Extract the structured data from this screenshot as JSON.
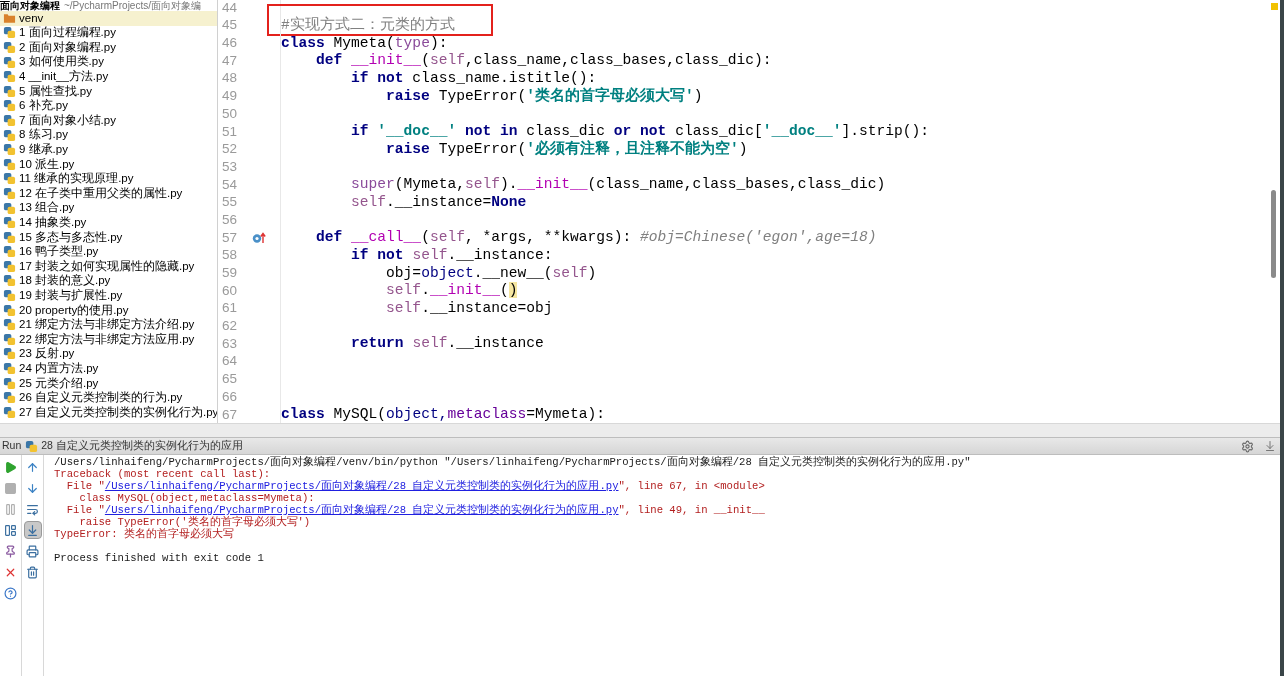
{
  "sidebar": {
    "project": "面向对象编程",
    "path": "~/PycharmProjects/面向对象编",
    "items": [
      {
        "label": "venv",
        "kind": "folder",
        "selected": true
      },
      {
        "label": "1 面向过程编程.py",
        "kind": "file",
        "selected": false
      },
      {
        "label": "2 面向对象编程.py",
        "kind": "file",
        "selected": false
      },
      {
        "label": "3 如何使用类.py",
        "kind": "file",
        "selected": false
      },
      {
        "label": "4 __init__方法.py",
        "kind": "file",
        "selected": false
      },
      {
        "label": "5 属性查找.py",
        "kind": "file",
        "selected": false
      },
      {
        "label": "6 补充.py",
        "kind": "file",
        "selected": false
      },
      {
        "label": "7 面向对象小结.py",
        "kind": "file",
        "selected": false
      },
      {
        "label": "8 练习.py",
        "kind": "file",
        "selected": false
      },
      {
        "label": "9 继承.py",
        "kind": "file",
        "selected": false
      },
      {
        "label": "10 派生.py",
        "kind": "file",
        "selected": false
      },
      {
        "label": "11 继承的实现原理.py",
        "kind": "file",
        "selected": false
      },
      {
        "label": "12 在子类中重用父类的属性.py",
        "kind": "file",
        "selected": false
      },
      {
        "label": "13 组合.py",
        "kind": "file",
        "selected": false
      },
      {
        "label": "14 抽象类.py",
        "kind": "file",
        "selected": false
      },
      {
        "label": "15 多态与多态性.py",
        "kind": "file",
        "selected": false
      },
      {
        "label": "16 鸭子类型.py",
        "kind": "file",
        "selected": false
      },
      {
        "label": "17 封装之如何实现属性的隐藏.py",
        "kind": "file",
        "selected": false
      },
      {
        "label": "18 封装的意义.py",
        "kind": "file",
        "selected": false
      },
      {
        "label": "19 封装与扩展性.py",
        "kind": "file",
        "selected": false
      },
      {
        "label": "20 property的使用.py",
        "kind": "file",
        "selected": false
      },
      {
        "label": "21 绑定方法与非绑定方法介绍.py",
        "kind": "file",
        "selected": false
      },
      {
        "label": "22 绑定方法与非绑定方法应用.py",
        "kind": "file",
        "selected": false
      },
      {
        "label": "23 反射.py",
        "kind": "file",
        "selected": false
      },
      {
        "label": "24 内置方法.py",
        "kind": "file",
        "selected": false
      },
      {
        "label": "25 元类介绍.py",
        "kind": "file",
        "selected": false
      },
      {
        "label": "26 自定义元类控制类的行为.py",
        "kind": "file",
        "selected": false
      },
      {
        "label": "27 自定义元类控制类的实例化行为.py",
        "kind": "file",
        "selected": false
      }
    ]
  },
  "editor": {
    "lines": [
      {
        "number": "44",
        "boxed": false,
        "override": false
      },
      {
        "number": "45",
        "boxed": true,
        "override": false,
        "tokens": [
          {
            "kind": "note",
            "text": "#实现方式二：元类的方式"
          }
        ]
      },
      {
        "number": "46",
        "boxed": false,
        "override": false,
        "tokens": [
          {
            "kind": "kw",
            "text": "class"
          },
          {
            "kind": "plain",
            "text": " Mymeta("
          },
          {
            "kind": "builtin",
            "text": "type"
          },
          {
            "kind": "plain",
            "text": "):"
          }
        ]
      },
      {
        "number": "47",
        "boxed": false,
        "override": false,
        "tokens": [
          {
            "kind": "kw",
            "text": "    def "
          },
          {
            "kind": "magic",
            "text": "__init__"
          },
          {
            "kind": "plain",
            "text": "("
          },
          {
            "kind": "self",
            "text": "self"
          },
          {
            "kind": "plain",
            "text": ",class_name,class_bases,class_dic):"
          }
        ]
      },
      {
        "number": "48",
        "boxed": false,
        "override": false,
        "tokens": [
          {
            "kind": "kw",
            "text": "        if not"
          },
          {
            "kind": "plain",
            "text": " class_name.istitle():"
          }
        ]
      },
      {
        "number": "49",
        "boxed": false,
        "override": false,
        "tokens": [
          {
            "kind": "kw",
            "text": "            raise"
          },
          {
            "kind": "plain",
            "text": " TypeError("
          },
          {
            "kind": "str",
            "text": "'类名的首字母必须大写'"
          },
          {
            "kind": "plain",
            "text": ")"
          }
        ]
      },
      {
        "number": "50",
        "boxed": false,
        "override": false
      },
      {
        "number": "51",
        "boxed": false,
        "override": false,
        "tokens": [
          {
            "kind": "kw",
            "text": "        if "
          },
          {
            "kind": "str",
            "text": "'__doc__'"
          },
          {
            "kind": "kw",
            "text": " not in"
          },
          {
            "kind": "plain",
            "text": " class_dic "
          },
          {
            "kind": "kw",
            "text": "or not"
          },
          {
            "kind": "plain",
            "text": " class_dic["
          },
          {
            "kind": "str",
            "text": "'__doc__'"
          },
          {
            "kind": "plain",
            "text": "].strip():"
          }
        ]
      },
      {
        "number": "52",
        "boxed": false,
        "override": false,
        "tokens": [
          {
            "kind": "kw",
            "text": "            raise"
          },
          {
            "kind": "plain",
            "text": " TypeError("
          },
          {
            "kind": "str",
            "text": "'必须有注释，且注释不能为空'"
          },
          {
            "kind": "plain",
            "text": ")"
          }
        ]
      },
      {
        "number": "53",
        "boxed": false,
        "override": false
      },
      {
        "number": "54",
        "boxed": false,
        "override": false,
        "tokens": [
          {
            "kind": "builtin",
            "text": "        super"
          },
          {
            "kind": "plain",
            "text": "(Mymeta,"
          },
          {
            "kind": "self",
            "text": "self"
          },
          {
            "kind": "plain",
            "text": ")."
          },
          {
            "kind": "magic",
            "text": "__init__"
          },
          {
            "kind": "plain",
            "text": "(class_name,class_bases,class_dic)"
          }
        ]
      },
      {
        "number": "55",
        "boxed": false,
        "override": false,
        "tokens": [
          {
            "kind": "self",
            "text": "        self"
          },
          {
            "kind": "plain",
            "text": ".__instance="
          },
          {
            "kind": "kw",
            "text": "None"
          }
        ]
      },
      {
        "number": "56",
        "boxed": false,
        "override": false
      },
      {
        "number": "57",
        "boxed": false,
        "override": true,
        "tokens": [
          {
            "kind": "kw",
            "text": "    def "
          },
          {
            "kind": "magic",
            "text": "__call__"
          },
          {
            "kind": "plain",
            "text": "("
          },
          {
            "kind": "self",
            "text": "self"
          },
          {
            "kind": "plain",
            "text": ", *args, **kwargs): "
          },
          {
            "kind": "comment",
            "text": "#obj=Chinese('egon',age=18)"
          }
        ]
      },
      {
        "number": "58",
        "boxed": false,
        "override": false,
        "tokens": [
          {
            "kind": "kw",
            "text": "        if not "
          },
          {
            "kind": "self",
            "text": "self"
          },
          {
            "kind": "plain",
            "text": ".__instance:"
          }
        ]
      },
      {
        "number": "59",
        "boxed": false,
        "override": false,
        "tokens": [
          {
            "kind": "plain",
            "text": "            obj="
          },
          {
            "kind": "name",
            "text": "object"
          },
          {
            "kind": "plain",
            "text": ".__new__("
          },
          {
            "kind": "self",
            "text": "self"
          },
          {
            "kind": "plain",
            "text": ")"
          }
        ]
      },
      {
        "number": "60",
        "boxed": false,
        "override": false,
        "tokens": [
          {
            "kind": "self",
            "text": "            self"
          },
          {
            "kind": "plain",
            "text": "."
          },
          {
            "kind": "magic",
            "text": "__init__"
          },
          {
            "kind": "plain",
            "text": "("
          },
          {
            "kind": "matched",
            "text": ")"
          }
        ]
      },
      {
        "number": "61",
        "boxed": false,
        "override": false,
        "tokens": [
          {
            "kind": "self",
            "text": "            self"
          },
          {
            "kind": "plain",
            "text": ".__instance=obj"
          }
        ]
      },
      {
        "number": "62",
        "boxed": false,
        "override": false
      },
      {
        "number": "63",
        "boxed": false,
        "override": false,
        "tokens": [
          {
            "kind": "kw",
            "text": "        return "
          },
          {
            "kind": "self",
            "text": "self"
          },
          {
            "kind": "plain",
            "text": ".__instance"
          }
        ]
      },
      {
        "number": "64",
        "boxed": false,
        "override": false
      },
      {
        "number": "65",
        "boxed": false,
        "override": false
      },
      {
        "number": "66",
        "boxed": false,
        "override": false
      },
      {
        "number": "67",
        "boxed": false,
        "override": false,
        "tokens": [
          {
            "kind": "kw",
            "text": "class"
          },
          {
            "kind": "plain",
            "text": " MySQL("
          },
          {
            "kind": "name",
            "text": "object,"
          },
          {
            "kind": "kwarg",
            "text": "metaclass"
          },
          {
            "kind": "plain",
            "text": "=Mymeta):"
          }
        ]
      }
    ]
  },
  "run": {
    "label": "Run",
    "config": "28 自定义元类控制类的实例化行为的应用",
    "left_tools": [
      {
        "kind": "run",
        "pressed": false
      },
      {
        "kind": "stop",
        "pressed": false
      },
      {
        "kind": "pause",
        "pressed": false
      },
      {
        "kind": "layout",
        "pressed": false
      },
      {
        "kind": "pin",
        "pressed": false
      },
      {
        "kind": "close",
        "pressed": false
      },
      {
        "kind": "help",
        "pressed": false
      }
    ],
    "right_tools": [
      {
        "kind": "up",
        "pressed": false
      },
      {
        "kind": "down",
        "pressed": false
      },
      {
        "kind": "wrap",
        "pressed": false
      },
      {
        "kind": "scroll",
        "pressed": true
      },
      {
        "kind": "print",
        "pressed": false
      },
      {
        "kind": "trash",
        "pressed": false
      }
    ],
    "console": [
      {
        "kind": "command",
        "segments": [
          {
            "kind": "text",
            "text": "/Users/linhaifeng/PycharmProjects/面向对象编程/venv/bin/python \"/Users/linhaifeng/PycharmProjects/面向对象编程/28 自定义元类控制类的实例化行为的应用.py\""
          }
        ]
      },
      {
        "kind": "error",
        "segments": [
          {
            "kind": "text",
            "text": "Traceback (most recent call last):"
          }
        ]
      },
      {
        "kind": "error",
        "segments": [
          {
            "kind": "text",
            "text": "  File \""
          },
          {
            "kind": "link",
            "text": "/Users/linhaifeng/PycharmProjects/面向对象编程/28 自定义元类控制类的实例化行为的应用.py"
          },
          {
            "kind": "text",
            "text": "\", line 67, in <module>"
          }
        ]
      },
      {
        "kind": "error",
        "segments": [
          {
            "kind": "text",
            "text": "    class MySQL(object,metaclass=Mymeta):"
          }
        ]
      },
      {
        "kind": "error",
        "segments": [
          {
            "kind": "text",
            "text": "  File \""
          },
          {
            "kind": "link",
            "text": "/Users/linhaifeng/PycharmProjects/面向对象编程/28 自定义元类控制类的实例化行为的应用.py"
          },
          {
            "kind": "text",
            "text": "\", line 49, in __init__"
          }
        ]
      },
      {
        "kind": "error",
        "segments": [
          {
            "kind": "text",
            "text": "    raise TypeError('类名的首字母必须大写')"
          }
        ]
      },
      {
        "kind": "error",
        "segments": [
          {
            "kind": "text",
            "text": "TypeError: 类名的首字母必须大写"
          }
        ]
      },
      {
        "kind": "status",
        "segments": [
          {
            "kind": "text",
            "text": "Process finished with exit code 1"
          }
        ]
      }
    ]
  }
}
